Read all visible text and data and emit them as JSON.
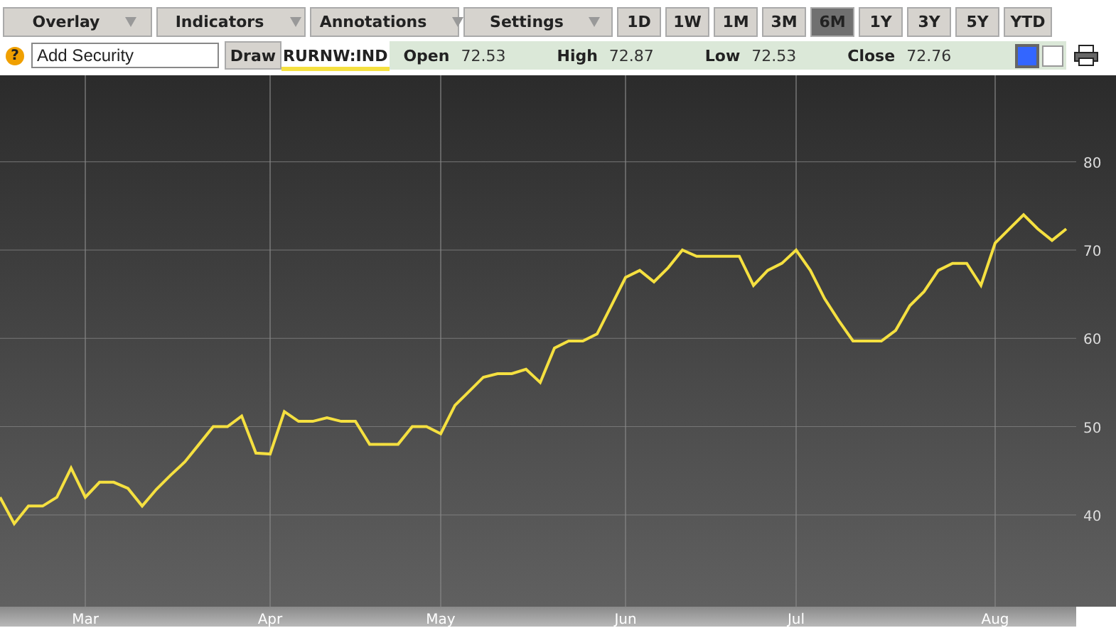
{
  "menus": [
    {
      "label": "Overlay"
    },
    {
      "label": "Indicators"
    },
    {
      "label": "Annotations"
    },
    {
      "label": "Settings"
    }
  ],
  "ranges": [
    {
      "label": "1D",
      "selected": false
    },
    {
      "label": "1W",
      "selected": false
    },
    {
      "label": "1M",
      "selected": false
    },
    {
      "label": "3M",
      "selected": false
    },
    {
      "label": "6M",
      "selected": true
    },
    {
      "label": "1Y",
      "selected": false
    },
    {
      "label": "3Y",
      "selected": false
    },
    {
      "label": "5Y",
      "selected": false
    },
    {
      "label": "YTD",
      "selected": false
    }
  ],
  "help": "?",
  "search": {
    "placeholder": "Add Security"
  },
  "draw_button": "Draw",
  "quotes": [
    {
      "label": "Open",
      "value": "72.53"
    },
    {
      "label": "High",
      "value": "72.87"
    },
    {
      "label": "Low",
      "value": "72.53"
    },
    {
      "label": "Close",
      "value": "72.76"
    }
  ],
  "swatches": [
    {
      "color": "#3366ff",
      "selected": true
    },
    {
      "color": "#ffffff",
      "selected": false
    }
  ],
  "chart_data": {
    "type": "line",
    "grid": true,
    "ylim": [
      29.6,
      89.8
    ],
    "yticks": [
      40,
      50,
      60,
      70,
      80
    ],
    "categories": [
      null,
      null,
      null,
      null,
      null,
      null,
      "Mar",
      null,
      null,
      null,
      null,
      null,
      null,
      null,
      null,
      null,
      null,
      null,
      null,
      "Apr",
      null,
      null,
      null,
      null,
      null,
      null,
      null,
      null,
      null,
      null,
      null,
      "May",
      null,
      null,
      null,
      null,
      null,
      null,
      null,
      null,
      null,
      null,
      null,
      null,
      "Jun",
      null,
      null,
      null,
      null,
      null,
      null,
      null,
      null,
      null,
      null,
      null,
      "Jul",
      null,
      null,
      null,
      null,
      null,
      null,
      null,
      null,
      null,
      null,
      null,
      null,
      null,
      "Aug",
      null,
      null,
      null,
      null,
      null
    ],
    "series": [
      {
        "name": "RURNW:IND",
        "color": "#f5e040",
        "values": [
          42,
          39,
          41,
          41,
          42,
          45.3,
          42,
          43.7,
          43.7,
          43,
          41,
          42.9,
          44.5,
          46,
          48,
          50,
          50,
          51.2,
          47,
          46.9,
          51.7,
          50.6,
          50.6,
          51,
          50.6,
          50.6,
          48,
          48,
          48,
          50,
          50,
          49.2,
          52.4,
          54,
          55.6,
          56,
          56,
          56.5,
          55,
          58.9,
          59.7,
          59.7,
          60.5,
          63.7,
          66.9,
          67.7,
          66.4,
          68,
          70,
          69.3,
          69.3,
          69.3,
          69.3,
          66,
          67.7,
          68.5,
          70,
          67.7,
          64.5,
          62,
          59.7,
          59.7,
          59.7,
          60.9,
          63.7,
          65.3,
          67.7,
          68.5,
          68.5,
          66,
          70.8,
          72.4,
          74,
          72.4,
          71.1,
          72.4
        ]
      }
    ]
  }
}
